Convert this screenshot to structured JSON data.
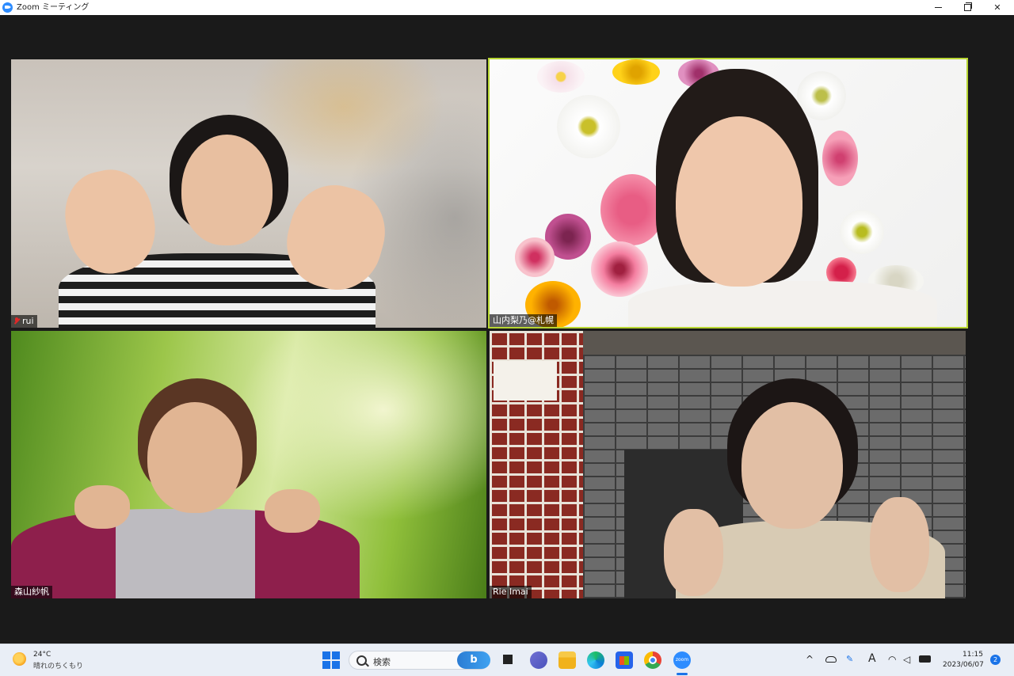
{
  "window": {
    "title": "Zoom ミーティング",
    "controls": {
      "minimize": "–",
      "maximize": "❐",
      "close": "✕"
    }
  },
  "participants": [
    {
      "name": "rui",
      "muted": true
    },
    {
      "name": "山内梨乃@札幌",
      "active_speaker": true
    },
    {
      "name": "森山紗帆"
    },
    {
      "name": "Rie Imai"
    }
  ],
  "colors": {
    "active_speaker_border": "#b8d633",
    "meeting_bg": "#1a1a1a",
    "zoom_blue": "#2d8cff"
  },
  "taskbar": {
    "weather": {
      "temp": "24°C",
      "desc": "晴れのちくもり",
      "icon": "sun-cloud-icon"
    },
    "search_placeholder": "検索",
    "bing_label": "b",
    "zoom_label": "zoom",
    "pinned": [
      "start-icon",
      "task-view-icon",
      "teams-icon",
      "file-explorer-icon",
      "edge-icon",
      "store-icon",
      "chrome-icon",
      "zoom-icon"
    ],
    "tray": {
      "chevron": "^",
      "ime": "A"
    },
    "clock": {
      "time": "11:15",
      "date": "2023/06/07"
    },
    "notifications": "2"
  }
}
